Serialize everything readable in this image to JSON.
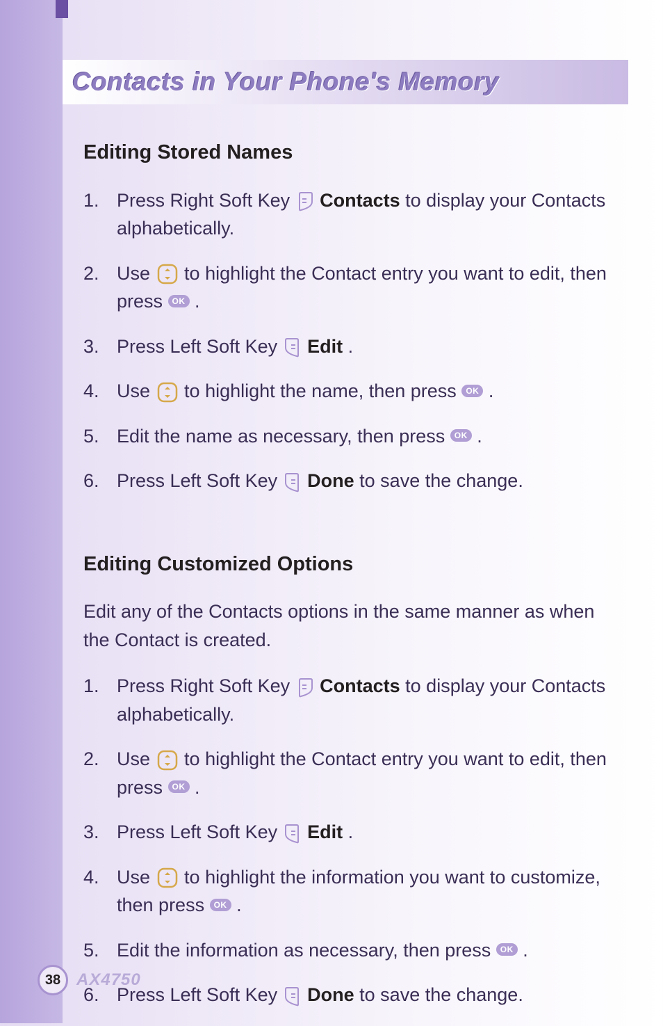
{
  "title": "Contacts in Your Phone's Memory",
  "section1": {
    "heading": "Editing Stored Names",
    "steps": [
      {
        "pre": "Press Right Soft Key ",
        "bold": "Contacts",
        "post": " to display your Contacts alphabetically."
      },
      {
        "pre": "Use ",
        "mid": " to highlight the Contact entry you want to edit, then press ",
        "post": "."
      },
      {
        "pre": "Press Left Soft Key ",
        "bold": "Edit",
        "post": "."
      },
      {
        "pre": "Use ",
        "mid": " to highlight the name, then press ",
        "post": "."
      },
      {
        "pre": "Edit the name as necessary, then press ",
        "post": "."
      },
      {
        "pre": "Press Left Soft Key ",
        "bold": "Done",
        "post": " to save the change."
      }
    ]
  },
  "section2": {
    "heading": "Editing Customized Options",
    "intro": "Edit any of the Contacts options in the same manner as when the Contact is created.",
    "steps": [
      {
        "pre": "Press Right Soft Key ",
        "bold": "Contacts",
        "post": " to display your Contacts alphabetically."
      },
      {
        "pre": "Use ",
        "mid": " to highlight the Contact entry you want to edit, then press ",
        "post": "."
      },
      {
        "pre": "Press Left Soft Key ",
        "bold": "Edit",
        "post": "."
      },
      {
        "pre": "Use ",
        "mid": " to highlight the information you want to customize, then press ",
        "post": "."
      },
      {
        "pre": "Edit the information as necessary, then press ",
        "post": "."
      },
      {
        "pre": "Press Left Soft Key ",
        "bold": "Done",
        "post": " to save the change."
      }
    ]
  },
  "footer": {
    "page": "38",
    "model": "AX4750"
  },
  "icons": {
    "ok_label": "OK"
  }
}
